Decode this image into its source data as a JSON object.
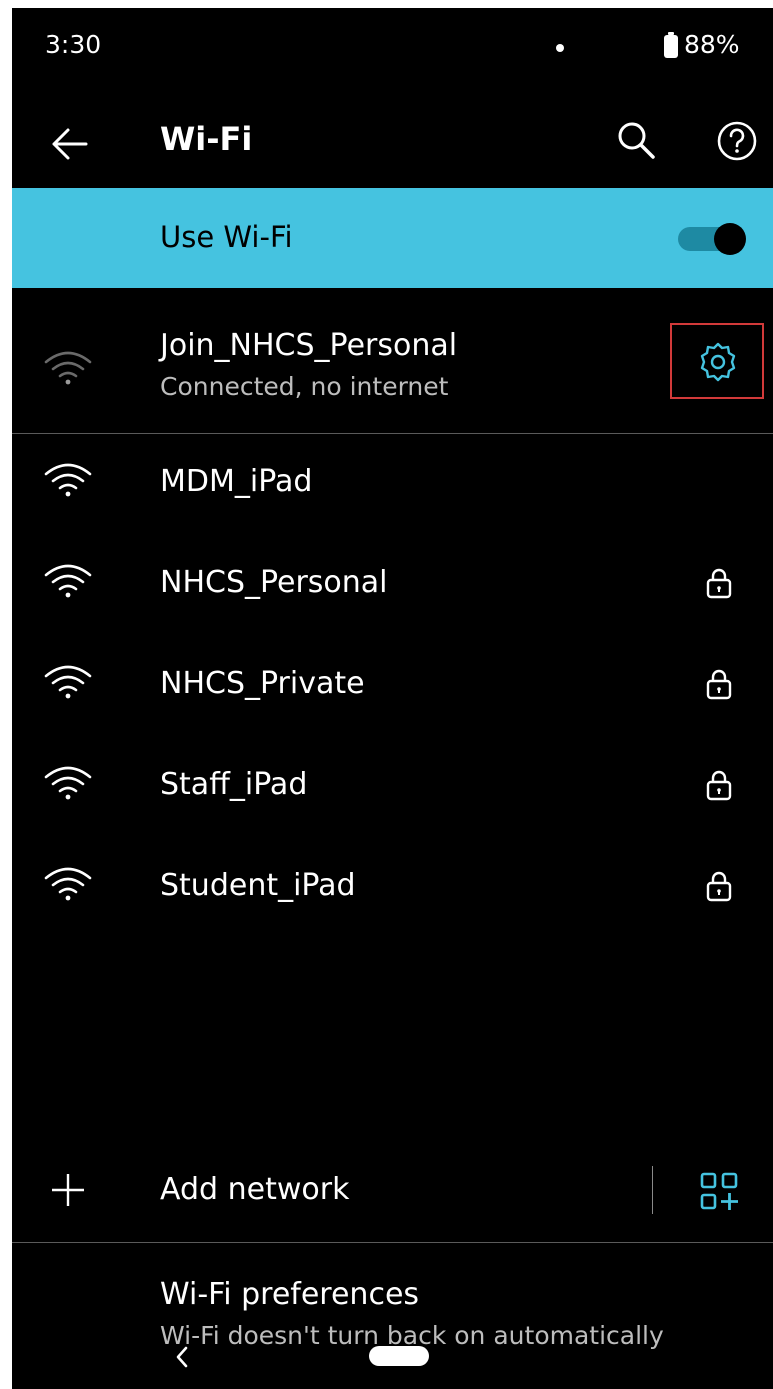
{
  "status_bar": {
    "time": "3:30",
    "battery": "88%"
  },
  "app_bar": {
    "title": "Wi-Fi",
    "back_icon": "back-arrow-icon",
    "search_icon": "search-icon",
    "help_icon": "help-icon"
  },
  "use_wifi": {
    "label": "Use Wi-Fi",
    "enabled": true,
    "color": "#45c3e0"
  },
  "connected_network": {
    "name": "Join_NHCS_Personal",
    "status": "Connected, no internet",
    "settings_icon": "gear-icon",
    "accent_color": "#45c3e0"
  },
  "networks": [
    {
      "name": "MDM_iPad",
      "secured": false
    },
    {
      "name": "NHCS_Personal",
      "secured": true
    },
    {
      "name": "NHCS_Private",
      "secured": true
    },
    {
      "name": "Staff_iPad",
      "secured": true
    },
    {
      "name": "Student_iPad",
      "secured": true
    }
  ],
  "add_network": {
    "label": "Add network",
    "qr_icon": "qr-scan-icon"
  },
  "preferences": {
    "title": "Wi-Fi preferences",
    "subtitle": "Wi-Fi doesn't turn back on automatically"
  }
}
